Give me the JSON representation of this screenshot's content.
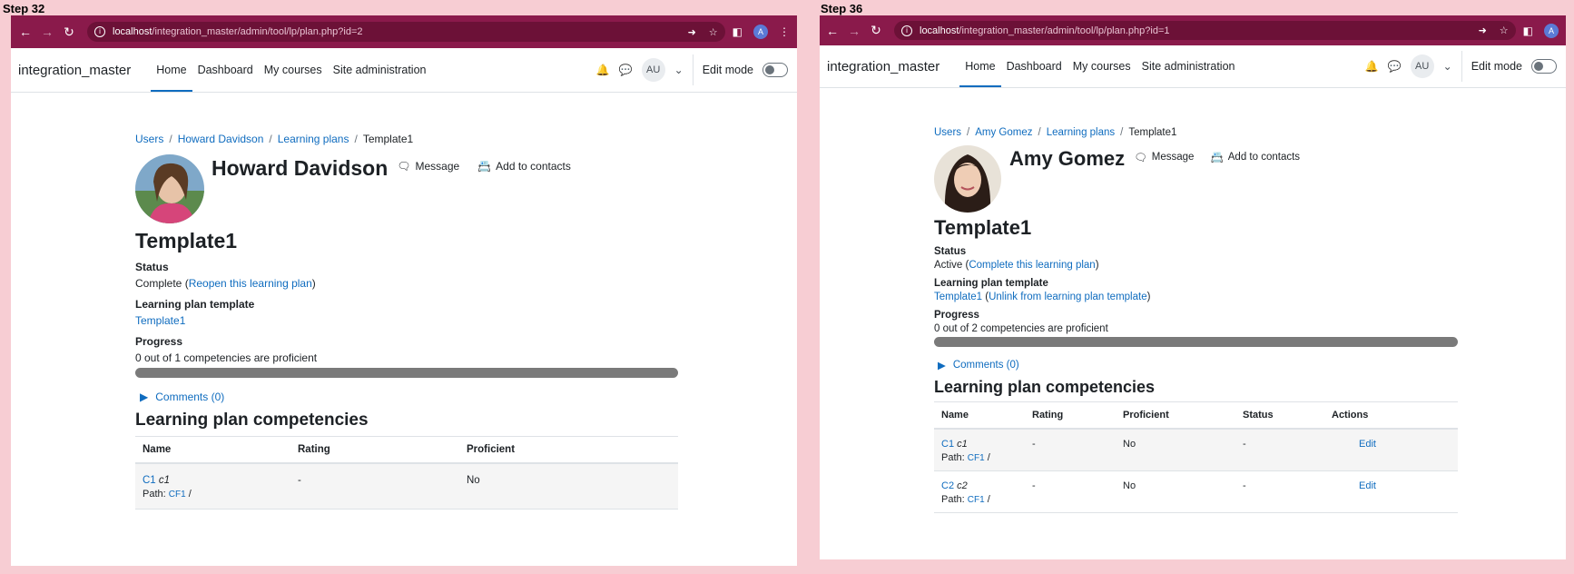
{
  "left": {
    "step": "Step 32",
    "url_host": "localhost",
    "url_path": "/integration_master/admin/tool/lp/plan.php?id=2",
    "profile_initial": "A",
    "site_name": "integration_master",
    "nav": [
      "Home",
      "Dashboard",
      "My courses",
      "Site administration"
    ],
    "user_initials": "AU",
    "edit_mode": "Edit mode",
    "breadcrumb": [
      "Users",
      "Howard Davidson",
      "Learning plans",
      "Template1"
    ],
    "user_name": "Howard Davidson",
    "message": "Message",
    "add_contacts": "Add to contacts",
    "plan_title": "Template1",
    "status_label": "Status",
    "status_value": "Complete (",
    "status_link": "Reopen this learning plan",
    "status_close": ")",
    "template_label": "Learning plan template",
    "template_link": "Template1",
    "progress_label": "Progress",
    "progress_text": "0 out of 1 competencies are proficient",
    "progress_fraction": 0,
    "comments": "Comments (0)",
    "section_title": "Learning plan competencies",
    "columns": [
      "Name",
      "Rating",
      "Proficient"
    ],
    "rows": [
      {
        "code": "C1",
        "name": "c1",
        "path_label": "Path:",
        "path_link": "CF1",
        "path_sep": "/",
        "rating": "-",
        "proficient": "No"
      }
    ]
  },
  "right": {
    "step": "Step 36",
    "url_host": "localhost",
    "url_path": "/integration_master/admin/tool/lp/plan.php?id=1",
    "profile_initial": "A",
    "site_name": "integration_master",
    "nav": [
      "Home",
      "Dashboard",
      "My courses",
      "Site administration"
    ],
    "user_initials": "AU",
    "edit_mode": "Edit mode",
    "breadcrumb": [
      "Users",
      "Amy Gomez",
      "Learning plans",
      "Template1"
    ],
    "user_name": "Amy Gomez",
    "message": "Message",
    "add_contacts": "Add to contacts",
    "plan_title": "Template1",
    "status_label": "Status",
    "status_value": "Active (",
    "status_link": "Complete this learning plan",
    "status_close": ")",
    "template_label": "Learning plan template",
    "template_link": "Template1",
    "template_paren_open": " (",
    "unlink_link": "Unlink from learning plan template",
    "template_paren_close": ")",
    "progress_label": "Progress",
    "progress_text": "0 out of 2 competencies are proficient",
    "progress_fraction": 0,
    "comments": "Comments (0)",
    "section_title": "Learning plan competencies",
    "columns": [
      "Name",
      "Rating",
      "Proficient",
      "Status",
      "Actions"
    ],
    "rows": [
      {
        "code": "C1",
        "name": "c1",
        "path_label": "Path:",
        "path_link": "CF1",
        "path_sep": "/",
        "rating": "-",
        "proficient": "No",
        "status": "-",
        "action": "Edit"
      },
      {
        "code": "C2",
        "name": "c2",
        "path_label": "Path:",
        "path_link": "CF1",
        "path_sep": "/",
        "rating": "-",
        "proficient": "No",
        "status": "-",
        "action": "Edit"
      }
    ]
  },
  "colors": {
    "browser_bar": "#8a1a4b",
    "link": "#0f6cbf",
    "frame": "#f7cdd3"
  }
}
